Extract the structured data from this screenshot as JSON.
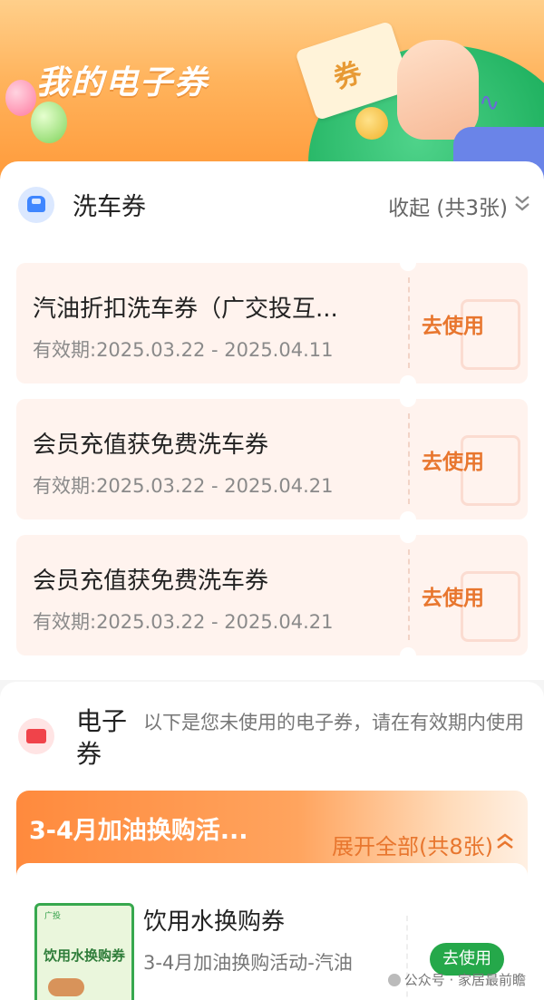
{
  "banner": {
    "title": "我的电子券",
    "ticket_glyph": "券"
  },
  "car_wash": {
    "title": "洗车券",
    "collapse_label": "收起 (共3张)",
    "coupons": [
      {
        "name": "汽油折扣洗车券（广交投互...",
        "validity": "有效期:2025.03.22 - 2025.04.11",
        "action": "去使用"
      },
      {
        "name": "会员充值获免费洗车券",
        "validity": "有效期:2025.03.22 - 2025.04.21",
        "action": "去使用"
      },
      {
        "name": "会员充值获免费洗车券",
        "validity": "有效期:2025.03.22 - 2025.04.21",
        "action": "去使用"
      }
    ]
  },
  "e_coupons": {
    "title": "电子券",
    "description": "以下是您未使用的电子券，请在有效期内使用",
    "promo": {
      "title": "3-4月加油换购活...",
      "expand_label": "展开全部(共8张)",
      "item": {
        "thumb_text": "饮用水换购券",
        "thumb_brand": "广投",
        "name": "饮用水换购券",
        "subtitle": "3-4月加油换购活动-汽油",
        "action": "去使用"
      }
    }
  },
  "watermark": "公众号 · 家居最前瞻",
  "colors": {
    "accent": "#e8762e",
    "green": "#25a84a",
    "blue": "#3f86ff",
    "red": "#f0434a"
  }
}
